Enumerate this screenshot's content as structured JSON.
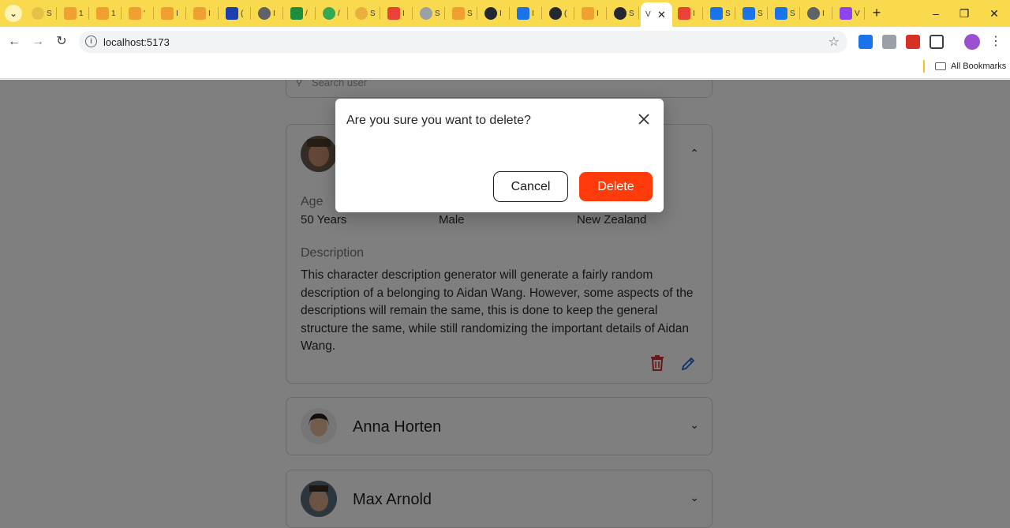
{
  "browser": {
    "tab_letters": [
      "S",
      "1",
      "1",
      "'",
      "I",
      "I",
      "(",
      "I",
      "/",
      "/",
      "S",
      "I",
      "S",
      "S",
      "I",
      "I",
      "(",
      "I",
      "S",
      "I",
      "S",
      "S",
      "S",
      "I",
      "V"
    ],
    "active_tab_letter": "V",
    "url": "localhost:5173",
    "bookmarks_label": "All Bookmarks"
  },
  "search": {
    "placeholder": "Search user"
  },
  "cards": [
    {
      "expanded": true,
      "fields": [
        {
          "label": "Age",
          "value": "50 Years"
        },
        {
          "label": "",
          "value": "Male"
        },
        {
          "label": "",
          "value": "New Zealand"
        }
      ],
      "description_label": "Description",
      "description": "This character description generator will generate a fairly random description of a belonging to Aidan Wang. However, some aspects of the descriptions will remain the same, this is done to keep the general structure the same, while still randomizing the important details of Aidan Wang."
    },
    {
      "name": "Anna Horten",
      "expanded": false
    },
    {
      "name": "Max Arnold",
      "expanded": false
    }
  ],
  "dialog": {
    "title": "Are you sure you want to delete?",
    "cancel_label": "Cancel",
    "delete_label": "Delete"
  },
  "colors": {
    "delete": "#ff3b0b",
    "trash_icon": "#d32f2f",
    "edit_icon": "#1e66c9",
    "tabstrip": "#f9d94d"
  }
}
